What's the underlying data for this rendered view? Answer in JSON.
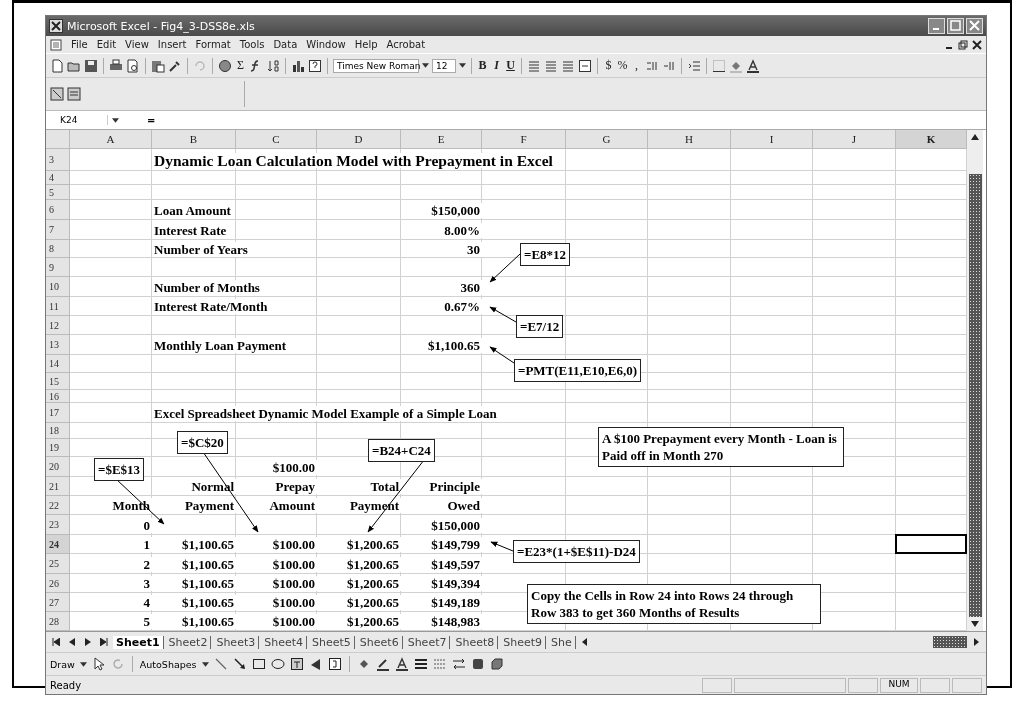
{
  "window": {
    "title": "Microsoft Excel - Fig4_3-DSS8e.xls"
  },
  "menu": [
    "File",
    "Edit",
    "View",
    "Insert",
    "Format",
    "Tools",
    "Data",
    "Window",
    "Help",
    "Acrobat"
  ],
  "standard_toolbar": {
    "sum": "Σ",
    "font": "Times New Roman",
    "size": "12"
  },
  "format_buttons": [
    {
      "label": "B"
    },
    {
      "label": "I"
    },
    {
      "label": "U"
    }
  ],
  "number_buttons": [
    "$",
    "%",
    ","
  ],
  "formula_bar": {
    "name_box": "K24",
    "equals": "="
  },
  "sheet": {
    "columns": [
      {
        "label": "A",
        "selected": false
      },
      {
        "label": "B",
        "selected": false
      },
      {
        "label": "C",
        "selected": false
      },
      {
        "label": "D",
        "selected": false
      },
      {
        "label": "E",
        "selected": false
      },
      {
        "label": "F",
        "selected": false
      },
      {
        "label": "G",
        "selected": false
      },
      {
        "label": "H",
        "selected": false
      },
      {
        "label": "I",
        "selected": false
      },
      {
        "label": "J",
        "selected": false
      },
      {
        "label": "K",
        "selected": true
      }
    ],
    "rows": [
      {
        "number": "3",
        "selected": false,
        "kind": "title",
        "cells": [
          "",
          "Dynamic Loan Calculation Model with Prepayment in Excel"
        ]
      },
      {
        "number": "4",
        "selected": false,
        "cells": []
      },
      {
        "number": "5",
        "selected": false,
        "cells": []
      },
      {
        "number": "6",
        "selected": false,
        "kind": "label",
        "cells": [
          "",
          "Loan Amount",
          "",
          "",
          "$150,000"
        ]
      },
      {
        "number": "7",
        "selected": false,
        "kind": "label",
        "cells": [
          "",
          "Interest Rate",
          "",
          "",
          "8.00%"
        ]
      },
      {
        "number": "8",
        "selected": false,
        "kind": "label",
        "cells": [
          "",
          "Number of Years",
          "",
          "",
          "30"
        ]
      },
      {
        "number": "9",
        "selected": false,
        "cells": []
      },
      {
        "number": "10",
        "selected": false,
        "kind": "label",
        "cells": [
          "",
          "Number of Months",
          "",
          "",
          "360"
        ]
      },
      {
        "number": "11",
        "selected": false,
        "kind": "label",
        "cells": [
          "",
          "Interest Rate/Month",
          "",
          "",
          "0.67%"
        ]
      },
      {
        "number": "12",
        "selected": false,
        "cells": []
      },
      {
        "number": "13",
        "selected": false,
        "kind": "label",
        "cells": [
          "",
          "Monthly Loan Payment",
          "",
          "",
          "$1,100.65"
        ]
      },
      {
        "number": "14",
        "selected": false,
        "cells": []
      },
      {
        "number": "15",
        "selected": false,
        "cells": []
      },
      {
        "number": "16",
        "selected": false,
        "cells": []
      },
      {
        "number": "17",
        "selected": false,
        "kind": "label",
        "cells": [
          "",
          "Excel Spreadsheet Dynamic Model Example of a Simple Loan"
        ]
      },
      {
        "number": "18",
        "selected": false,
        "cells": []
      },
      {
        "number": "19",
        "selected": false,
        "cells": []
      },
      {
        "number": "20",
        "selected": false,
        "kind": "data",
        "cells": [
          "",
          "",
          "$100.00"
        ]
      },
      {
        "number": "21",
        "selected": false,
        "kind": "data",
        "cells": [
          "",
          "Normal",
          "Prepay",
          "Total",
          "Principle"
        ]
      },
      {
        "number": "22",
        "selected": false,
        "kind": "data",
        "cells": [
          "Month",
          "Payment",
          "Amount",
          "Payment",
          "Owed"
        ]
      },
      {
        "number": "23",
        "selected": false,
        "kind": "data",
        "cells": [
          "0",
          "",
          "",
          "",
          "$150,000"
        ]
      },
      {
        "number": "24",
        "selected": true,
        "kind": "data",
        "cells": [
          "1",
          "$1,100.65",
          "$100.00",
          "$1,200.65",
          "$149,799"
        ]
      },
      {
        "number": "25",
        "selected": false,
        "kind": "data",
        "cells": [
          "2",
          "$1,100.65",
          "$100.00",
          "$1,200.65",
          "$149,597"
        ]
      },
      {
        "number": "26",
        "selected": false,
        "kind": "data",
        "cells": [
          "3",
          "$1,100.65",
          "$100.00",
          "$1,200.65",
          "$149,394"
        ]
      },
      {
        "number": "27",
        "selected": false,
        "kind": "data",
        "cells": [
          "4",
          "$1,100.65",
          "$100.00",
          "$1,200.65",
          "$149,189"
        ]
      },
      {
        "number": "28",
        "selected": false,
        "kind": "data",
        "cells": [
          "5",
          "$1,100.65",
          "$100.00",
          "$1,200.65",
          "$148,983"
        ]
      }
    ]
  },
  "callouts": [
    "=E8*12",
    "=E7/12",
    "=PMT(E11,E10,E6,0)",
    "=$C$20",
    "=B24+C24",
    "=$E$13",
    "=E23*(1+$E$11)-D24",
    "A $100 Prepayment every Month - Loan is Paid off in Month 270",
    "Copy the Cells in Row 24 into Rows 24 through Row 383 to get 360 Months of Results"
  ],
  "sheet_tabs": [
    {
      "label": "Sheet1",
      "selected": true
    },
    {
      "label": "Sheet2",
      "selected": false
    },
    {
      "label": "Sheet3",
      "selected": false
    },
    {
      "label": "Sheet4",
      "selected": false
    },
    {
      "label": "Sheet5",
      "selected": false
    },
    {
      "label": "Sheet6",
      "selected": false
    },
    {
      "label": "Sheet7",
      "selected": false
    },
    {
      "label": "Sheet8",
      "selected": false
    },
    {
      "label": "Sheet9",
      "selected": false
    },
    {
      "label": "She",
      "selected": false
    }
  ],
  "draw_toolbar": {
    "draw": "Draw",
    "autoshapes": "AutoShapes"
  },
  "status_bar": {
    "status": "Ready",
    "num": "NUM"
  }
}
